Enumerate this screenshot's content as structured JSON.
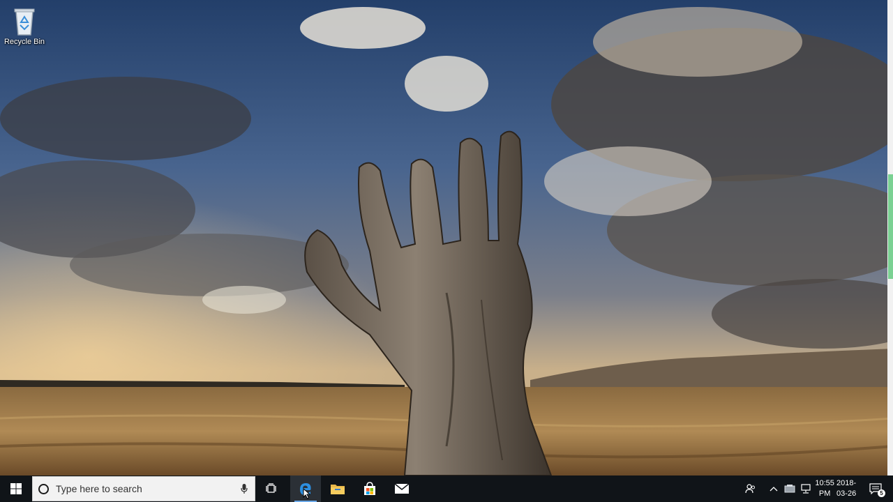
{
  "desktop": {
    "icons": [
      {
        "label": "Recycle Bin",
        "icon": "recycle-bin-icon"
      }
    ],
    "wallpaper": "hand-tree-stump-field"
  },
  "taskbar": {
    "start": {
      "icon": "windows-logo-icon"
    },
    "search": {
      "placeholder": "Type here to search",
      "icon": "cortana-ring-icon",
      "mic_icon": "microphone-icon"
    },
    "pinned": [
      {
        "name": "Task View",
        "icon": "task-view-icon"
      },
      {
        "name": "Microsoft Edge",
        "icon": "edge-icon",
        "active": true
      },
      {
        "name": "File Explorer",
        "icon": "folder-icon"
      },
      {
        "name": "Microsoft Store",
        "icon": "store-bag-icon"
      },
      {
        "name": "Mail",
        "icon": "mail-icon"
      }
    ],
    "tray": {
      "time": "10:55 PM",
      "date": "2018-03-26",
      "notification_count": "5"
    }
  },
  "colors": {
    "taskbar": "#101418",
    "accent": "#0078d7",
    "sky": "#2a4a78",
    "field": "#9a7a48"
  }
}
